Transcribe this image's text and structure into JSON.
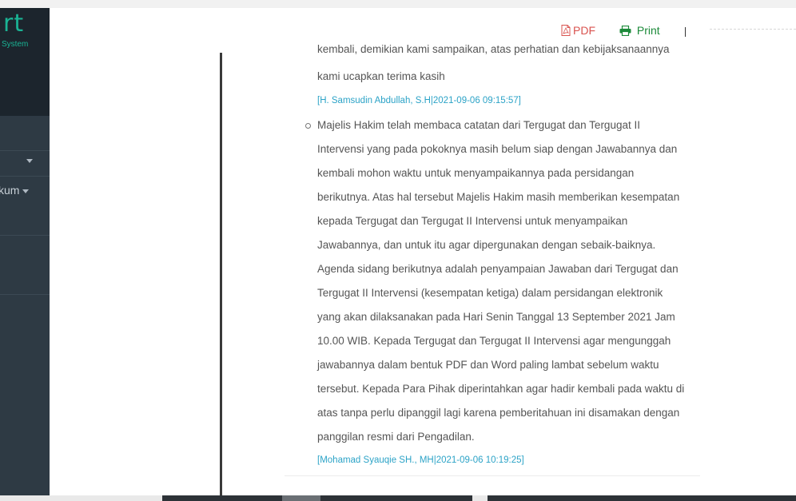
{
  "brand": {
    "logo": "rt",
    "subtitle": "System"
  },
  "sidebar": {
    "items": [
      {
        "label": ""
      },
      {
        "label": "kum"
      }
    ]
  },
  "header": {
    "pdf_label": "PDF",
    "print_label": "Print",
    "divider": "|"
  },
  "entries": {
    "prev_cut_line": "kembali, demikian kami sampaikan, atas perhatian dan kebijaksanaannya",
    "prev_last_line": "kami ucapkan terima kasih",
    "prev_signature": "[H. Samsudin Abdullah, S.H|2021-09-06 09:15:57]",
    "current_lines": [
      "Majelis Hakim telah membaca catatan dari Tergugat dan Tergugat II",
      "Intervensi yang pada pokoknya masih belum siap dengan Jawabannya dan",
      "kembali mohon waktu untuk menyampaikannya pada persidangan",
      "berikutnya. Atas hal tersebut Majelis Hakim masih memberikan kesempatan",
      "kepada Tergugat dan Tergugat II Intervensi untuk menyampaikan",
      "Jawabannya, dan untuk itu agar dipergunakan dengan sebaik-baiknya.",
      "Agenda sidang berikutnya adalah penyampaian Jawaban dari Tergugat dan",
      "Tergugat II Intervensi (kesempatan ketiga) dalam persidangan elektronik",
      "yang akan dilaksanakan pada Hari Senin Tanggal 13 September 2021 Jam",
      "10.00 WIB. Kepada Tergugat dan Tergugat II Intervensi agar mengunggah",
      "jawabannya dalam bentuk PDF dan Word paling lambat sebelum waktu",
      "tersebut. Kepada Para Pihak diperintahkan agar hadir kembali pada waktu di",
      "atas tanpa perlu dipanggil lagi karena pemberitahuan ini disamakan dengan",
      "panggilan resmi dari Pengadilan."
    ],
    "current_signature": "[Mohamad Syauqie SH., MH|2021-09-06 10:19:25]"
  },
  "colors": {
    "sidebar_bg": "#2e3a44",
    "brand_bg": "#1c252d",
    "accent": "#1ab394",
    "pdf": "#d9534f",
    "print": "#1c8a3a",
    "signature": "#2ca3c7"
  },
  "icons": {
    "pdf": "file-pdf-icon",
    "print": "printer-icon",
    "bullet": "circle-bullet-icon"
  }
}
